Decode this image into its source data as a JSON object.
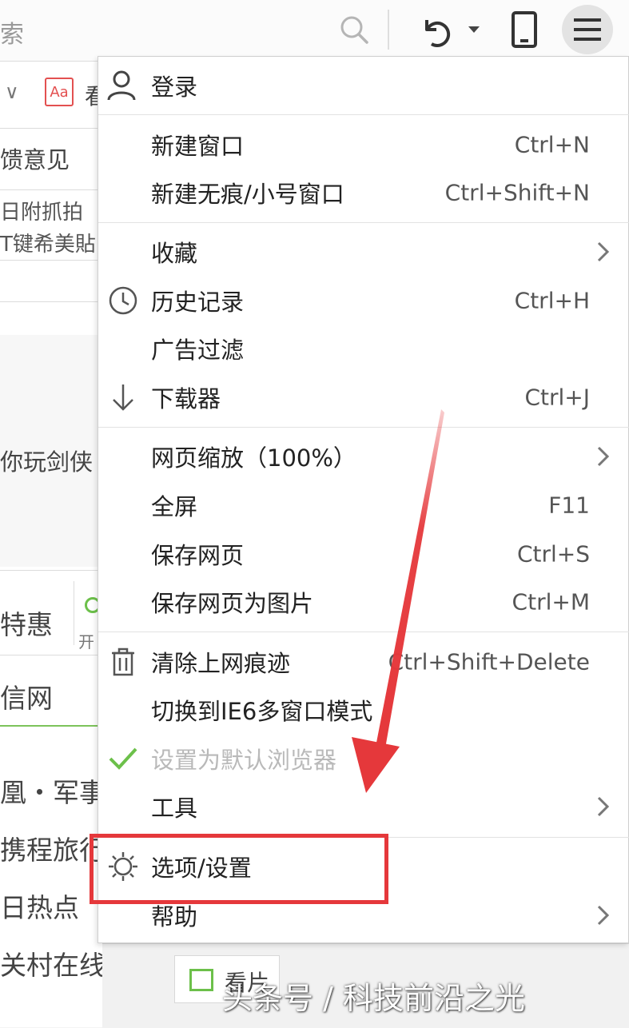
{
  "toolbar": {
    "search_fragment": "索",
    "icons": [
      "search-icon",
      "undo-icon",
      "chevron-down-icon",
      "phone-icon",
      "hamburger-menu-icon"
    ]
  },
  "background_page": {
    "aa_icon_text": "Aa",
    "feedback": "馈意见",
    "line1": "日附抓拍",
    "line2": "T键希美貼",
    "game_text": "你玩剑侠",
    "special": "特惠",
    "open_text": "开",
    "site1": "信网",
    "site2": "凰・军事",
    "site3": "携程旅行",
    "site4": "日热点",
    "site5": "关村在线",
    "movie_tab": "看片"
  },
  "menu": {
    "login": "登录",
    "items": [
      {
        "label": "新建窗口",
        "shortcut": "Ctrl+N"
      },
      {
        "label": "新建无痕/小号窗口",
        "shortcut": "Ctrl+Shift+N"
      },
      {
        "label": "收藏",
        "shortcut": ""
      },
      {
        "label": "历史记录",
        "shortcut": "Ctrl+H"
      },
      {
        "label": "广告过滤",
        "shortcut": ""
      },
      {
        "label": "下载器",
        "shortcut": "Ctrl+J"
      },
      {
        "label": "网页缩放（100%）",
        "shortcut": ""
      },
      {
        "label": "全屏",
        "shortcut": "F11"
      },
      {
        "label": "保存网页",
        "shortcut": "Ctrl+S"
      },
      {
        "label": "保存网页为图片",
        "shortcut": "Ctrl+M"
      },
      {
        "label": "清除上网痕迹",
        "shortcut": "Ctrl+Shift+Delete"
      },
      {
        "label": "切换到IE6多窗口模式",
        "shortcut": ""
      },
      {
        "label": "设置为默认浏览器",
        "shortcut": ""
      },
      {
        "label": "工具",
        "shortcut": ""
      },
      {
        "label": "选项/设置",
        "shortcut": ""
      },
      {
        "label": "帮助",
        "shortcut": ""
      }
    ]
  },
  "annotation": {
    "highlight_color": "#e5383b",
    "highlighted_item": "选项/设置"
  },
  "watermark": "头条号 / 科技前沿之光",
  "colors": {
    "accent_green": "#6cc04a",
    "menu_bg": "#ffffff",
    "toolbar_bg": "#fbfbfb"
  }
}
